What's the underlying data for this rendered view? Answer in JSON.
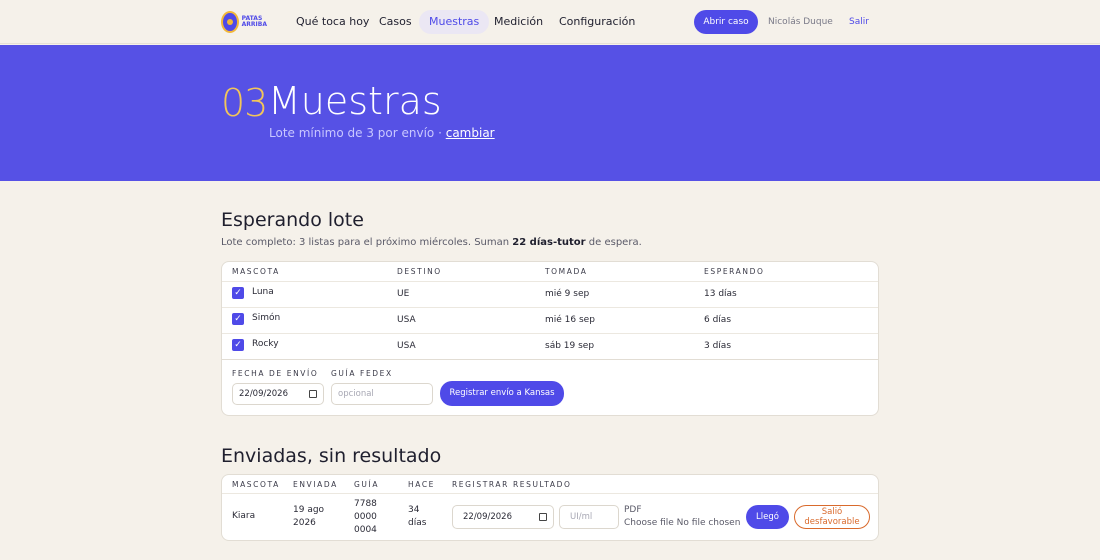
{
  "nav": {
    "logo_text": "PATAS ARRIBA",
    "items": [
      "Qué toca hoy",
      "Casos",
      "Muestras",
      "Medición",
      "Configuración"
    ],
    "active": "Muestras",
    "open_case": "Abrir caso",
    "user": "Nicolás Duque",
    "logout": "Salir"
  },
  "hero": {
    "number": "03",
    "title": "Muestras",
    "subtitle": "Lote mínimo de 3 por envío ·",
    "change_link": "cambiar"
  },
  "waiting": {
    "title": "Esperando lote",
    "desc_prefix": "Lote completo: 3 listas para el próximo miércoles. Suman",
    "desc_bold": "22 días-tutor",
    "desc_suffix": "de espera.",
    "headers": [
      "MASCOTA",
      "DESTINO",
      "TOMADA",
      "ESPERANDO"
    ],
    "rows": [
      {
        "pet": "Luna",
        "dest": "UE",
        "taken": "mié 9 sep",
        "waiting": "13 días"
      },
      {
        "pet": "Simón",
        "dest": "USA",
        "taken": "mié 16 sep",
        "waiting": "6 días"
      },
      {
        "pet": "Rocky",
        "dest": "USA",
        "taken": "sáb 19 sep",
        "waiting": "3 días"
      }
    ],
    "ship_date_label": "FECHA DE ENVÍO",
    "ship_date_value": "22/09/2026",
    "fedex_label": "GUÍA FEDEX",
    "fedex_placeholder": "opcional",
    "register_button": "Registrar envío a Kansas"
  },
  "sent": {
    "title": "Enviadas, sin resultado",
    "headers": [
      "MASCOTA",
      "ENVIADA",
      "GUÍA",
      "HACE",
      "REGISTRAR RESULTADO"
    ],
    "row": {
      "pet": "Kiara",
      "sent_line1": "19 ago",
      "sent_line2": "2026",
      "guide_1": "7788",
      "guide_2": "0000",
      "guide_3": "0004",
      "ago_1": "34",
      "ago_2": "días",
      "date_value": "22/09/2026",
      "ui_placeholder": "UI/ml",
      "pdf_label": "PDF",
      "file_choose": "Choose file",
      "file_none": "No file chosen",
      "arrived_button": "Llegó",
      "unfavorable_1": "Salió",
      "unfavorable_2": "desfavorable"
    }
  },
  "colors": {
    "accent": "#4f4ae8",
    "hero": "#5651e5",
    "number": "#f2c55a",
    "warning": "#d96a2c"
  }
}
